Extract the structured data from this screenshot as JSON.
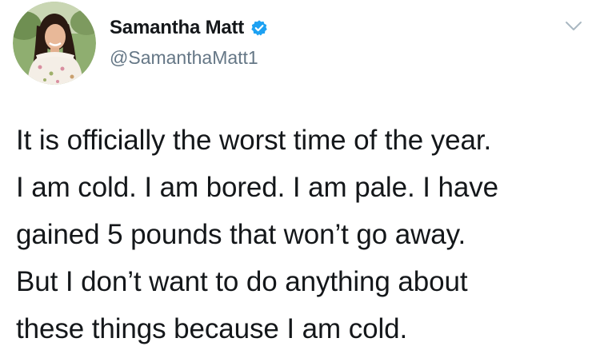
{
  "tweet": {
    "author": {
      "display_name": "Samantha Matt",
      "handle": "@SamanthaMatt1",
      "verified": true,
      "verified_color": "#1da1f2"
    },
    "text_lines": [
      "It is officially the worst time of the year.",
      "I am cold. I am bored. I am pale. I have",
      "gained 5 pounds that won’t go away.",
      "But I don’t want to do anything about",
      "these things because I am cold."
    ],
    "icons": {
      "verified": "verified-badge-icon",
      "menu": "chevron-down-icon"
    }
  }
}
